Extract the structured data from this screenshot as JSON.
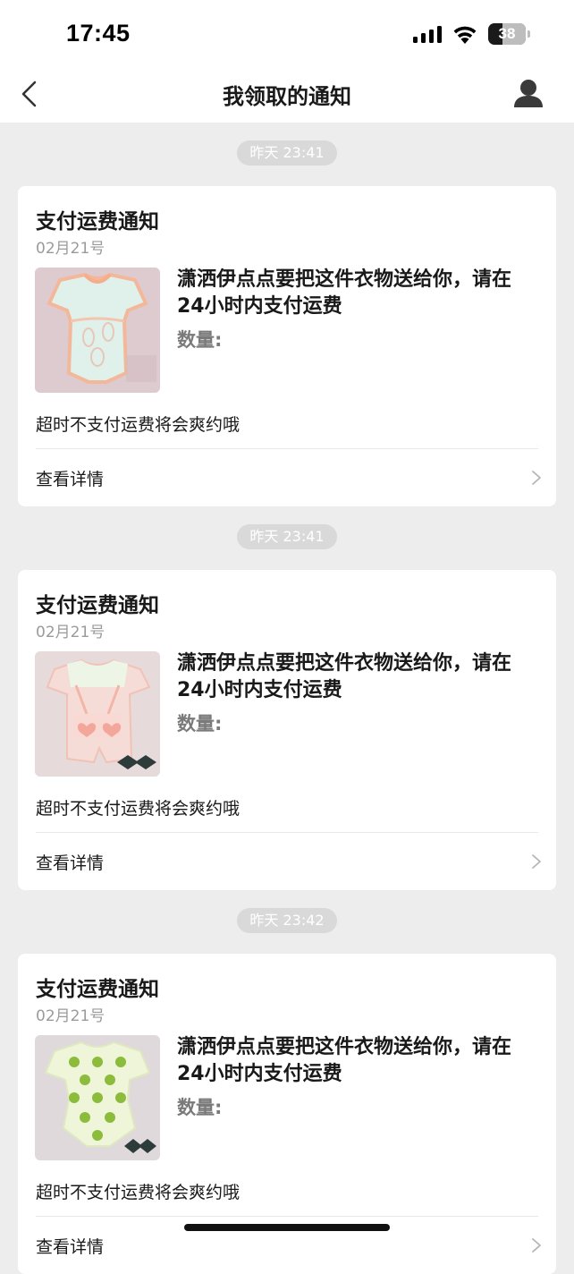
{
  "status_bar": {
    "time": "17:45",
    "battery_level": "38",
    "signal_icon": "cellular-signal-icon",
    "wifi_icon": "wifi-icon",
    "battery_icon": "battery-icon"
  },
  "nav": {
    "title": "我领取的通知",
    "back_icon": "chevron-left-icon",
    "profile_icon": "person-icon"
  },
  "messages": [
    {
      "time": "昨天 23:41",
      "card": {
        "title": "支付运费通知",
        "date": "02月21号",
        "message": "潇洒伊点点要把这件衣物送给你，请在24小时内支付运费",
        "quantity_label": "数量:",
        "note": "超时不支付运费将会爽约哦",
        "details_label": "查看详情",
        "image": "peach bodysuit with bunny print"
      }
    },
    {
      "time": "昨天 23:41",
      "card": {
        "title": "支付运费通知",
        "date": "02月21号",
        "message": "潇洒伊点点要把这件衣物送给你，请在24小时内支付运费",
        "quantity_label": "数量:",
        "note": "超时不支付运费将会爽约哦",
        "details_label": "查看详情",
        "image": "pink overall romper with heart pockets"
      }
    },
    {
      "time": "昨天 23:42",
      "card": {
        "title": "支付运费通知",
        "date": "02月21号",
        "message": "潇洒伊点点要把这件衣物送给你，请在24小时内支付运费",
        "quantity_label": "数量:",
        "note": "超时不支付运费将会爽约哦",
        "details_label": "查看详情",
        "image": "green kiwi print bodysuit"
      }
    }
  ],
  "colors": {
    "background": "#ededed",
    "card": "#ffffff",
    "time_badge": "#d9d9d9",
    "secondary_text": "#9b9b9b"
  }
}
